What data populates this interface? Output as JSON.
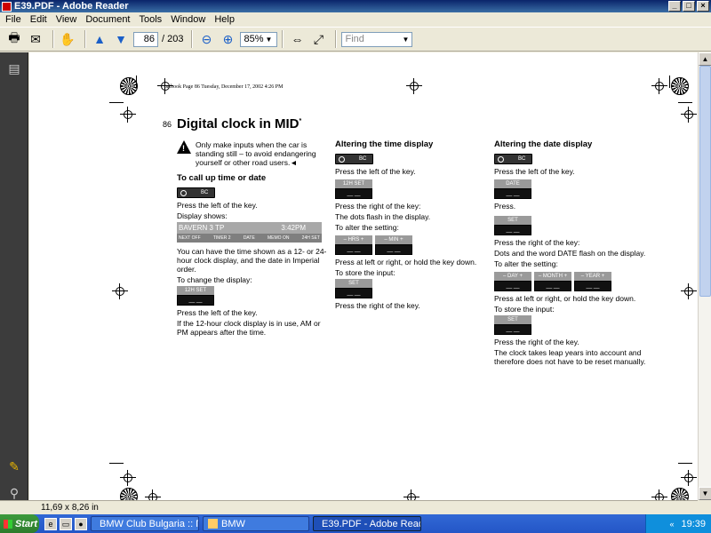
{
  "window": {
    "title": "E39.PDF - Adobe Reader",
    "controls": [
      "_",
      "□",
      "×"
    ]
  },
  "menu": [
    "File",
    "Edit",
    "View",
    "Document",
    "Tools",
    "Window",
    "Help"
  ],
  "toolbar": {
    "page_current": "86",
    "page_total": "/ 203",
    "zoom": "85%",
    "find_placeholder": "Find"
  },
  "status": {
    "page_size": "11,69 x 8,26 in"
  },
  "taskbar": {
    "start": "Start",
    "tasks": [
      {
        "label": "BMW Club Bulgaria :: Пр...",
        "active": false
      },
      {
        "label": "BMW",
        "active": false
      },
      {
        "label": "E39.PDF - Adobe Read...",
        "active": true
      }
    ],
    "tray_icons": "«",
    "clock": "19:39"
  },
  "page": {
    "header": "ba.book  Page 86  Tuesday, December 17, 2002  4:26 PM",
    "number": "86",
    "title": "Digital clock in MID",
    "title_mark": "*",
    "col1": {
      "warning": "Only make inputs when the car is standing still – to avoid endangering yourself or other road users.◄",
      "heading": "To call up time or date",
      "key_label": "BC",
      "p1": "Press the left of the key.",
      "p2": "Display shows:",
      "display_top_left": "BAVERN 3 TP",
      "display_top_right": "3:42PM",
      "display_bottom": [
        "NEXT OFF",
        "TIMER 2",
        "DATE",
        "MEMO ON",
        "24H SET"
      ],
      "p3": "You can have the time shown as a 12- or 24-hour clock display, and the date in Imperial order.",
      "p4": "To change the display:",
      "lcd1": "12H  SET",
      "p5": "Press the left of the key.",
      "p6": "If the 12-hour clock display is in use, AM or PM appears after the time."
    },
    "col2": {
      "heading": "Altering the time display",
      "key_label": "BC",
      "p1": "Press the left of the key.",
      "lcd1": "12H  SET",
      "p2": "Press the right of the key:",
      "p3": "The dots flash in the display.",
      "p4": "To alter the setting:",
      "lcd_hrs": "– HRS +",
      "lcd_min": "– MIN +",
      "p5": "Press at left or right, or hold the key down.",
      "p6": "To store the input:",
      "lcd_set": "SET",
      "p7": "Press the right of the key."
    },
    "col3": {
      "heading": "Altering the date display",
      "key_label": "BC",
      "p1": "Press the left of the key.",
      "lcd_date": "DATE",
      "p2": "Press.",
      "lcd_set": "SET",
      "p3": "Press the right of the key:",
      "p4": "Dots and the word DATE flash on the display.",
      "p5": "To alter the setting:",
      "lcd_day": "– DAY +",
      "lcd_month": "– MONTH +",
      "lcd_year": "– YEAR +",
      "p6": "Press at left or right, or hold the key down.",
      "p7": "To store the input:",
      "lcd_set2": "SET",
      "p8": "Press the right of the key.",
      "p9": "The clock takes leap years into account and therefore does not have to be reset manually."
    },
    "btn_marks": "__  __"
  }
}
